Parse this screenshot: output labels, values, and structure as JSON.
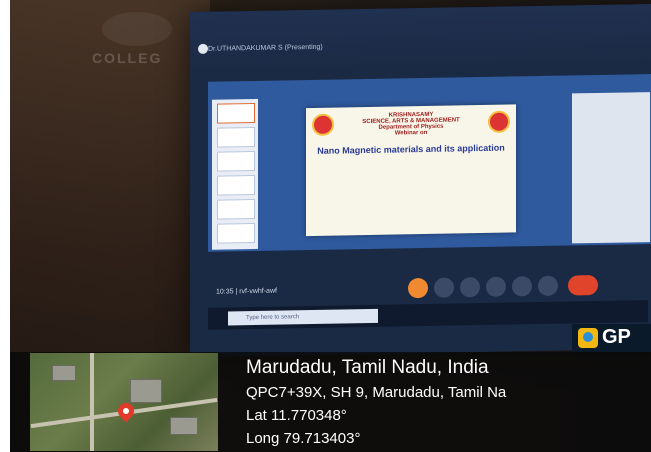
{
  "location": {
    "place": "Marudadu, Tamil Nadu, India",
    "address": "QPC7+39X, SH 9, Marudadu, Tamil Na",
    "lat": "Lat 11.770348°",
    "long": "Long 79.713403°"
  },
  "gps_brand": "GP",
  "background": {
    "college_sign": "COLLEG"
  },
  "meeting": {
    "presenter": "Dr.UTHANDAKUMAR S (Presenting)",
    "time": "10:35  |  rvf-vwhf-awf"
  },
  "slide": {
    "header": "KRISHNASAMY",
    "department_line": "SCIENCE, ARTS & MANAGEMENT",
    "department": "Department of Physics",
    "webinar": "Webinar on",
    "title": "Nano Magnetic materials and its application"
  },
  "taskbar": {
    "search_placeholder": "Type here to search"
  },
  "colors": {
    "pin": "#e23a2a",
    "end_call": "#e0442a",
    "gps_icon": "#f3b712"
  }
}
